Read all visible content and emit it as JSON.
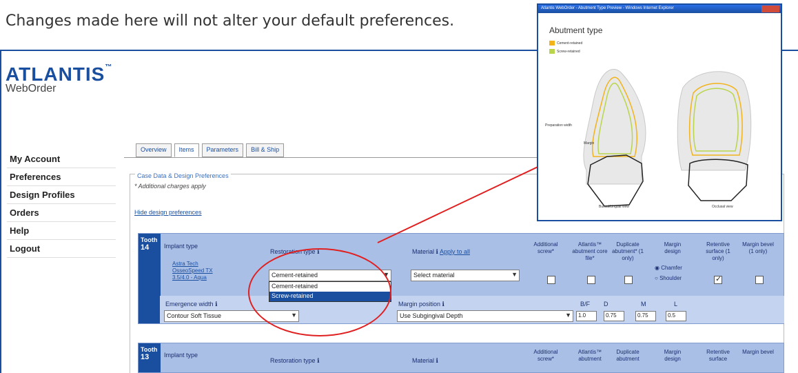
{
  "caption": "Changes made here will not alter your default preferences.",
  "logo": {
    "main": "ATLANTIS",
    "tm": "™",
    "sub": "WebOrder"
  },
  "sidebar": {
    "items": [
      {
        "label": "My Account"
      },
      {
        "label": "Preferences"
      },
      {
        "label": "Design Profiles"
      },
      {
        "label": "Orders"
      },
      {
        "label": "Help"
      },
      {
        "label": "Logout"
      }
    ]
  },
  "tabs": [
    {
      "label": "Overview"
    },
    {
      "label": "Items"
    },
    {
      "label": "Parameters"
    },
    {
      "label": "Bill & Ship"
    }
  ],
  "fieldset": {
    "legend": "Case Data & Design Preferences",
    "note": "* Additional charges apply",
    "hide_link": "Hide design preferences"
  },
  "tooth1": {
    "label": "Tooth",
    "number": "14",
    "implant_type_label": "Implant type",
    "implant_link": "Astra Tech OsseoSpeed TX 3.5/4.0 - Aqua",
    "restoration_label": "Restoration type",
    "restoration_value": "Cement-retained",
    "restoration_options": [
      "Cement-retained",
      "Screw-retained"
    ],
    "material_label": "Material",
    "apply_all": "Apply to all",
    "material_value": "Select material",
    "col_additional": "Additional screw*",
    "col_core": "Atlantis™ abutment core file*",
    "col_duplicate": "Duplicate abutment* (1 only)",
    "col_margin_design": "Margin design",
    "radio_chamfer": "Chamfer",
    "radio_shoulder": "Shoulder",
    "col_retentive": "Retentive surface (1 only)",
    "col_bevel": "Margin bevel (1 only)",
    "emergence_label": "Emergence width",
    "emergence_value": "Contour Soft Tissue",
    "margin_position_label": "Margin position",
    "margin_position_value": "Use Subgingival Depth",
    "hdr_bf": "B/F",
    "hdr_d": "D",
    "hdr_m": "M",
    "hdr_l": "L",
    "val_bf": "1.0",
    "val_d": "0.75",
    "val_m": "0.75",
    "val_l": "0.5"
  },
  "tooth2": {
    "label": "Tooth",
    "number": "13",
    "implant_type_label": "Implant type",
    "restoration_label": "Restoration type",
    "material_label": "Material",
    "col_additional": "Additional screw*",
    "col_core": "Atlantis™ abutment",
    "col_duplicate": "Duplicate abutment",
    "col_margin_design": "Margin design",
    "col_retentive": "Retentive surface",
    "col_bevel": "Margin bevel"
  },
  "popup": {
    "title": "Atlantis WebOrder - Abutment Type Preview - Windows Internet Explorer",
    "heading": "Abutment type",
    "legend_cement": "Cement-retained",
    "legend_screw": "Screw-retained",
    "label_margin": "Margin",
    "label_preparation": "Preparation width",
    "caption_left": "Buccal/Lingual view",
    "caption_right": "Occlusal view"
  },
  "colors": {
    "brand": "#1a4fa0",
    "highlight": "#e02020",
    "cement": "#f2b31b",
    "screw": "#b9d54a"
  }
}
